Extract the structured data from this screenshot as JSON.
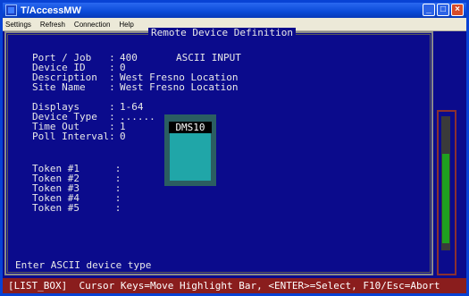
{
  "window": {
    "title": "T/AccessMW",
    "minimize_glyph": "_",
    "maximize_glyph": "□",
    "close_glyph": "×"
  },
  "menu": {
    "items": [
      "Settings",
      "Refresh",
      "Connection",
      "Help"
    ]
  },
  "screen": {
    "title": "Remote Device Definition",
    "fields": {
      "port_job": {
        "label": "Port / Job   :",
        "value": "400",
        "mode": "ASCII INPUT"
      },
      "device_id": {
        "label": "Device ID    :",
        "value": "0"
      },
      "description": {
        "label": "Description  :",
        "value": "West Fresno Location"
      },
      "site_name": {
        "label": "Site Name    :",
        "value": "West Fresno Location"
      },
      "displays": {
        "label": "Displays     :",
        "value": "1-64"
      },
      "device_type": {
        "label": "Device Type  :",
        "value": "......"
      },
      "time_out": {
        "label": "Time Out     :",
        "value": "1"
      },
      "poll_interval": {
        "label": "Poll Interval:",
        "value": "0"
      }
    },
    "tokens": [
      {
        "label": "Token #1      :"
      },
      {
        "label": "Token #2      :"
      },
      {
        "label": "Token #3      :"
      },
      {
        "label": "Token #4      :"
      },
      {
        "label": "Token #5      :"
      }
    ],
    "prompt": "Enter ASCII device type"
  },
  "popup": {
    "title": "DMS10"
  },
  "status_bar": {
    "text": "[LIST_BOX]  Cursor Keys=Move Highlight Bar, <ENTER>=Select, F10/Esc=Abort"
  },
  "colors": {
    "background": "#0b0b8c",
    "text": "#e8e8e8",
    "status_bar": "#8a1d1d",
    "popup_frame": "#2b5e61",
    "popup_list": "#20a6a8",
    "scroll_thumb": "#1fa01f"
  }
}
